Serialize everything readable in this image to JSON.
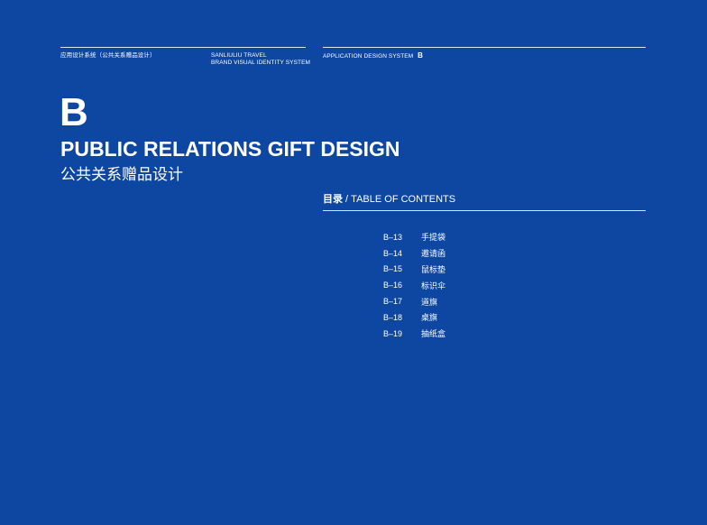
{
  "header": {
    "left_cn": "应用设计系统（公共关系赠品设计）",
    "middle_line1": "SANLIULIU TRAVEL",
    "middle_line2": "BRAND VISUAL IDENTITY SYSTEM",
    "right_label": "APPLICATION DESIGN SYSTEM",
    "right_letter": "B"
  },
  "section": {
    "letter": "B",
    "title_en": "PUBLIC RELATIONS GIFT DESIGN",
    "title_cn": "公共关系赠品设计"
  },
  "toc": {
    "heading_cn": "目录",
    "heading_sep": " / ",
    "heading_en": "TABLE OF CONTENTS",
    "items": [
      {
        "code": "B–13",
        "label": "手提袋"
      },
      {
        "code": "B–14",
        "label": "邀请函"
      },
      {
        "code": "B–15",
        "label": "鼠标垫"
      },
      {
        "code": "B–16",
        "label": "标识伞"
      },
      {
        "code": "B–17",
        "label": "道旗"
      },
      {
        "code": "B–18",
        "label": "桌旗"
      },
      {
        "code": "B–19",
        "label": "抽纸盒"
      }
    ]
  }
}
